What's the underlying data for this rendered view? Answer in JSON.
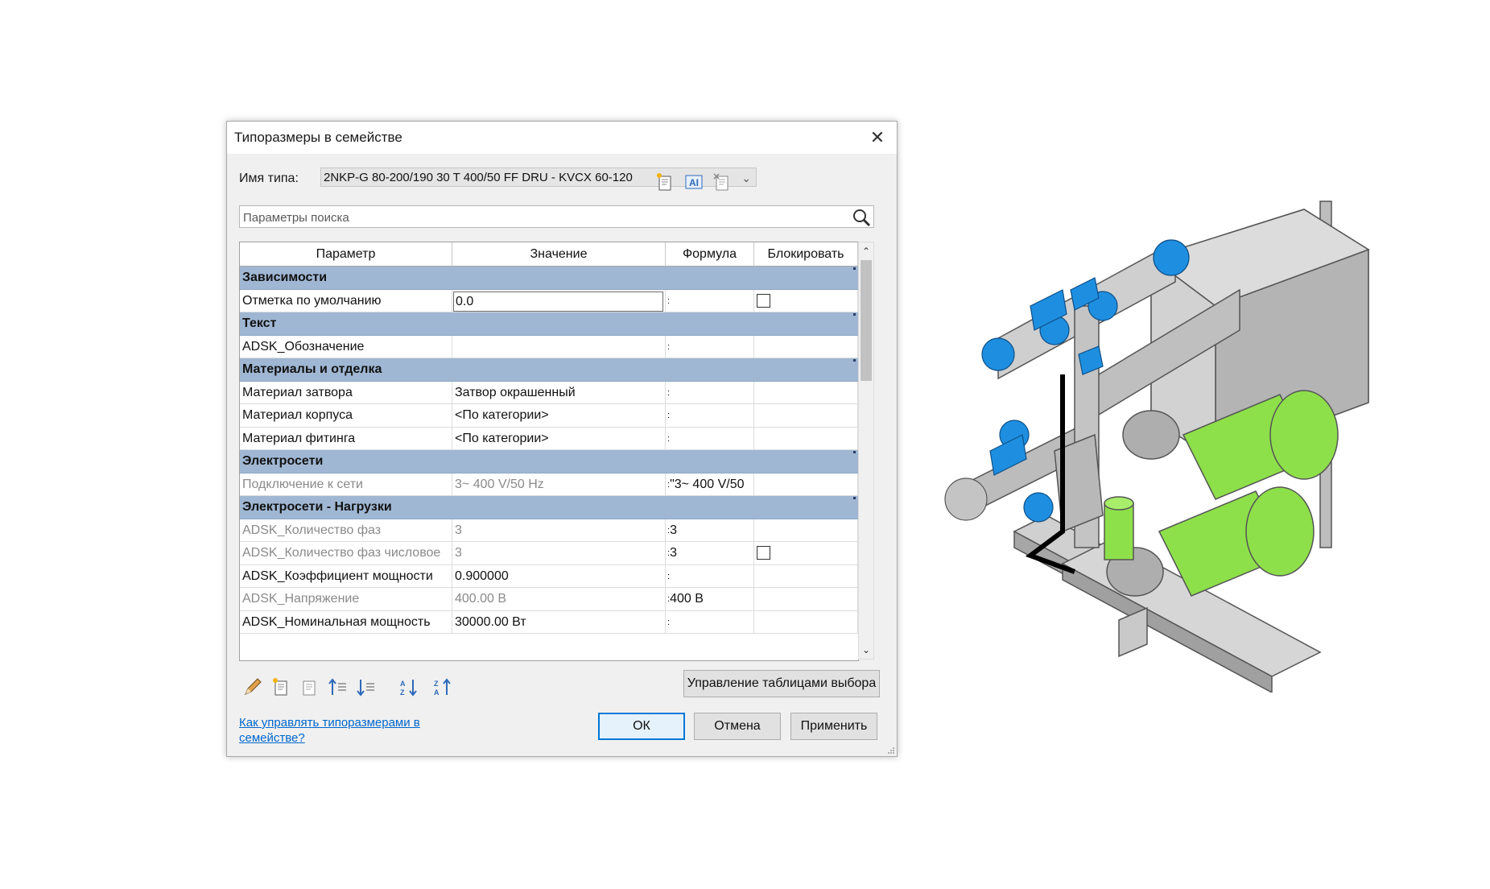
{
  "dialog": {
    "title": "Типоразмеры в семействе",
    "close_glyph": "✕",
    "type_name_label": "Имя типа:",
    "type_name_value": "2NKP-G 80-200/190 30 T 400/50 FF DRU - KVCX 60-120",
    "search_placeholder": "Параметры поиска",
    "columns": [
      "Параметр",
      "Значение",
      "Формула",
      "Блокировать"
    ],
    "rows": [
      {
        "kind": "group",
        "label": "Зависимости"
      },
      {
        "kind": "param",
        "name": "Отметка по умолчанию",
        "value": "0.0",
        "formula": "",
        "lock": true,
        "editing": true
      },
      {
        "kind": "group",
        "label": "Текст"
      },
      {
        "kind": "param",
        "name": "ADSK_Обозначение",
        "value": "",
        "formula": "",
        "lock": false
      },
      {
        "kind": "group",
        "label": "Материалы и отделка"
      },
      {
        "kind": "param",
        "name": "Материал затвора",
        "value": "Затвор окрашенный",
        "formula": "",
        "lock": false
      },
      {
        "kind": "param",
        "name": "Материал корпуса",
        "value": "<По категории>",
        "formula": "",
        "lock": false
      },
      {
        "kind": "param",
        "name": "Материал фитинга",
        "value": "<По категории>",
        "formula": "",
        "lock": false
      },
      {
        "kind": "group",
        "label": "Электросети"
      },
      {
        "kind": "param",
        "name": "Подключение к сети",
        "value": "3~ 400 V/50 Hz",
        "formula": "\"3~ 400 V/50",
        "lock": false,
        "dim": true
      },
      {
        "kind": "group",
        "label": "Электросети - Нагрузки"
      },
      {
        "kind": "param",
        "name": "ADSK_Количество фаз",
        "value": "3",
        "formula": "3",
        "lock": false,
        "dim": true
      },
      {
        "kind": "param",
        "name": "ADSK_Количество фаз числовое",
        "value": "3",
        "formula": "3",
        "lock": true,
        "dim": true
      },
      {
        "kind": "param",
        "name": "ADSK_Коэффициент мощности",
        "value": "0.900000",
        "formula": "",
        "lock": false
      },
      {
        "kind": "param",
        "name": "ADSK_Напряжение",
        "value": "400.00 В",
        "formula": "400 В",
        "lock": false,
        "dim": true
      },
      {
        "kind": "param",
        "name": "ADSK_Номинальная мощность",
        "value": "30000.00 Вт",
        "formula": "",
        "lock": false
      }
    ],
    "manage_lookup_label": "Управление таблицами выбора",
    "help_link": "Как управлять типоразмерами в семействе?",
    "ok_label": "ОК",
    "cancel_label": "Отмена",
    "apply_label": "Применить"
  },
  "colors": {
    "group_header": "#9fb7d3",
    "link": "#0066cc",
    "pipe_blue": "#1e8fe0",
    "motor_green": "#8ee04a",
    "housing_gray": "#c8c8c8"
  }
}
